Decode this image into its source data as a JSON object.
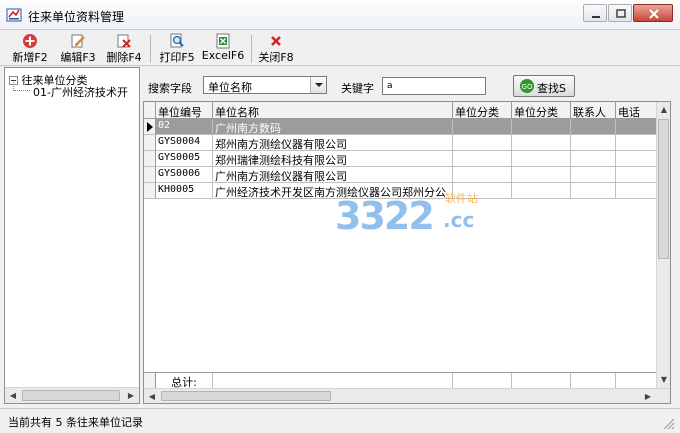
{
  "window": {
    "title": "往来单位资料管理"
  },
  "toolbar": {
    "add": "新增F2",
    "edit": "编辑F3",
    "delete": "删除F4",
    "print": "打印F5",
    "excel": "ExcelF6",
    "close": "关闭F8"
  },
  "tree": {
    "root": "往来单位分类",
    "child": "01-广州经济技术开"
  },
  "search": {
    "field_label": "搜索字段",
    "field_value": "单位名称",
    "keyword_label": "关键字",
    "keyword_value": "a",
    "button_label": "查找S"
  },
  "grid": {
    "columns": [
      "单位编号",
      "单位名称",
      "单位分类",
      "单位分类",
      "联系人",
      "电话"
    ],
    "rows": [
      [
        "02",
        "广州南方数码",
        "",
        "",
        "",
        ""
      ],
      [
        "GYS0004",
        "郑州南方测绘仪器有限公司",
        "",
        "",
        "",
        ""
      ],
      [
        "GYS0005",
        "郑州瑞律测绘科技有限公司",
        "",
        "",
        "",
        ""
      ],
      [
        "GYS0006",
        "广州南方测绘仪器有限公司",
        "",
        "",
        "",
        ""
      ],
      [
        "KH0005",
        "广州经济技术开发区南方测绘仪器公司郑州分公",
        "",
        "",
        "",
        ""
      ]
    ],
    "total_label": "总计:"
  },
  "status": {
    "text": "当前共有 5 条往来单位记录"
  },
  "watermark": {
    "number": "3322",
    "suffix": ".cc",
    "tag": "软件站"
  },
  "colors": {
    "selected_row": "#9c9c9c",
    "watermark_blue": "#3a8ee0",
    "watermark_orange": "#f0a020",
    "search_button_green": "#2a9a2a"
  }
}
